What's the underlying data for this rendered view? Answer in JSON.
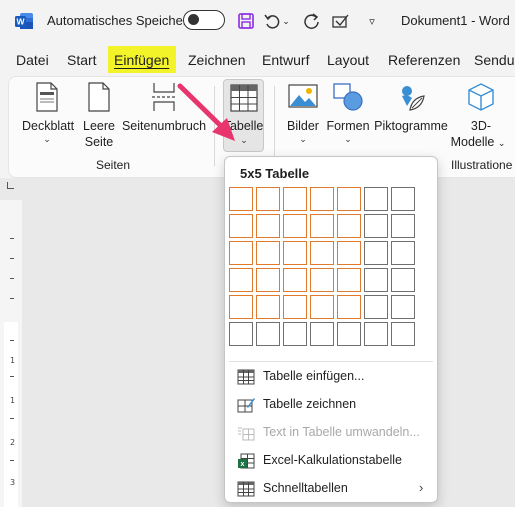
{
  "titlebar": {
    "app_logo": "word-logo-icon",
    "autosave_label": "Automatisches Speichern",
    "document_title": "Dokument1 - Word"
  },
  "tabs": [
    {
      "label": "Datei"
    },
    {
      "label": "Start"
    },
    {
      "label": "Einfügen",
      "active": true
    },
    {
      "label": "Zeichnen"
    },
    {
      "label": "Entwurf"
    },
    {
      "label": "Layout"
    },
    {
      "label": "Referenzen"
    },
    {
      "label": "Sendu"
    }
  ],
  "ribbon": {
    "seiten": {
      "group_label": "Seiten",
      "deckblatt": "Deckblatt",
      "leere_seite_1": "Leere",
      "leere_seite_2": "Seite",
      "seitenumbruch": "Seitenumbruch"
    },
    "tabelle": {
      "label": "Tabelle"
    },
    "illustrationen": {
      "group_label": "Illustratione",
      "bilder": "Bilder",
      "formen": "Formen",
      "piktogramme": "Piktogramme",
      "modelle_1": "3D-",
      "modelle_2": "Modelle"
    }
  },
  "dropdown": {
    "grid_title": "5x5 Tabelle",
    "grid": {
      "cols": 7,
      "rows": 6,
      "selected_cols": 5,
      "selected_rows": 5
    },
    "items": [
      {
        "label": "Tabelle einfügen...",
        "icon": "table-insert-icon",
        "enabled": true
      },
      {
        "label": "Tabelle zeichnen",
        "icon": "table-draw-icon",
        "enabled": true
      },
      {
        "label": "Text in Tabelle umwandeln...",
        "icon": "text-to-table-icon",
        "enabled": false
      },
      {
        "label": "Excel-Kalkulationstabelle",
        "icon": "excel-sheet-icon",
        "enabled": true
      },
      {
        "label": "Schnelltabellen",
        "icon": "quick-tables-icon",
        "enabled": true
      }
    ]
  },
  "ruler": {
    "labels": [
      "1",
      "1",
      "2",
      "3"
    ]
  },
  "colors": {
    "active_tab_highlight": "#f3f32a",
    "grid_selected": "#e07a2e",
    "annotation_arrow": "#e8356d",
    "word_blue": "#185abd"
  }
}
